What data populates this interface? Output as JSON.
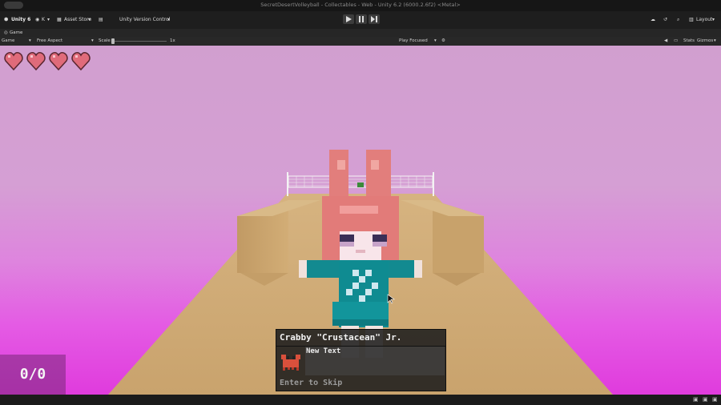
{
  "window": {
    "title": "SecretDesertVolleyball - Collectables - Web - Unity 6.2 (6000.2.6f2) <Metal>"
  },
  "toolbar": {
    "unity_label": "Unity 6",
    "account_label": "K",
    "asset_store_label": "Asset Store",
    "version_control_label": "Unity Version Control",
    "layout_label": "Layout"
  },
  "tab": {
    "label": "Game"
  },
  "game_header": {
    "display_label": "Game",
    "aspect_label": "Free Aspect",
    "scale_label": "Scale",
    "scale_value": "1x",
    "play_mode_label": "Play Focused",
    "stats_label": "Stats",
    "gizmos_label": "Gizmos"
  },
  "hud": {
    "hearts": 4,
    "score_text": "0/0"
  },
  "dialog": {
    "speaker": "Crabby \"Crustacean\" Jr.",
    "text": "New Text",
    "hint": "Enter to Skip",
    "portrait_icon": "crab-icon"
  },
  "colors": {
    "sky_top": "#d19fcf",
    "sky_bottom": "#e03bdd",
    "sand": "#cda872",
    "hair": "#e07b7b",
    "outfit": "#0d8a8f"
  }
}
